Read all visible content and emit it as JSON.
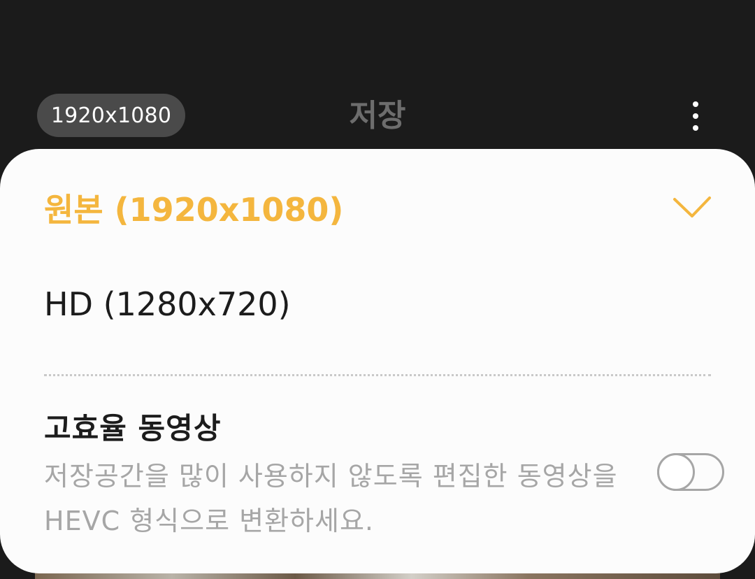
{
  "header": {
    "resolution_chip": "1920x1080",
    "title": "저장",
    "more_icon": "more-vertical-icon"
  },
  "resolution_options": [
    {
      "label": "원본 (1920x1080)",
      "selected": true,
      "color": "#f4b63e"
    },
    {
      "label": "HD (1280x720)",
      "selected": false
    }
  ],
  "selected_icon": "check-icon",
  "hevc": {
    "title": "고효율 동영상",
    "description": "저장공간을 많이 사용하지 않도록 편집한 동영상을 HEVC 형식으로 변환하세요.",
    "toggle_on": false
  },
  "colors": {
    "accent": "#f4b63e",
    "background": "#1b1b1b",
    "sheet": "#fcfcfc"
  }
}
